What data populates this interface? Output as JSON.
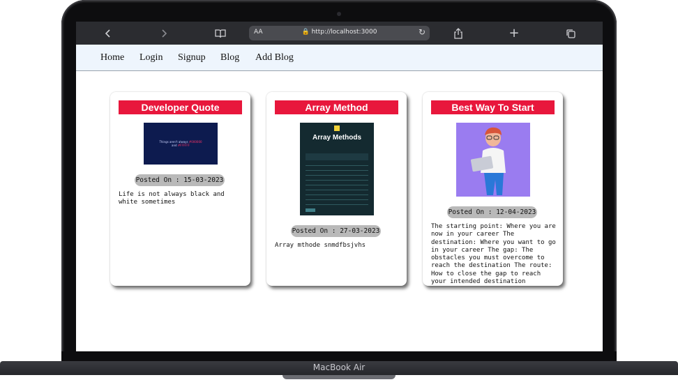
{
  "browser": {
    "aa_label": "AA",
    "url": "http://localhost:3000",
    "icons": {
      "back": "‹",
      "forward": "›",
      "book": "book-icon",
      "share": "share-icon",
      "new_tab": "+",
      "tabs": "tabs-icon"
    }
  },
  "nav": {
    "items": [
      "Home",
      "Login",
      "Signup",
      "Blog",
      "Add Blog"
    ]
  },
  "cards": [
    {
      "title": "Developer Quote",
      "posted": "Posted On : 15-03-2023",
      "description": "Life is not always black and white sometimes",
      "image_text": [
        "Things aren't always ",
        "#000000",
        " and ",
        "#FFFFFF"
      ]
    },
    {
      "title": "Array Method",
      "posted": "Posted On : 27-03-2023",
      "description": "Array mthode snmdfbsjvhs",
      "image_text": [
        "Array Methods"
      ]
    },
    {
      "title": "Best Way To Start",
      "posted": "Posted On : 12-04-2023",
      "description": "The starting point: Where you are now in your career The destination: Where you want to go in your career The gap: The obstacles you must overcome to reach the destination The route: How to close the gap to reach your intended destination"
    }
  ],
  "device": {
    "brand": "MacBook Air"
  },
  "colors": {
    "accent": "#e8173c",
    "nav_bg": "#eef5fd",
    "badge_bg": "#b9b9b9"
  }
}
